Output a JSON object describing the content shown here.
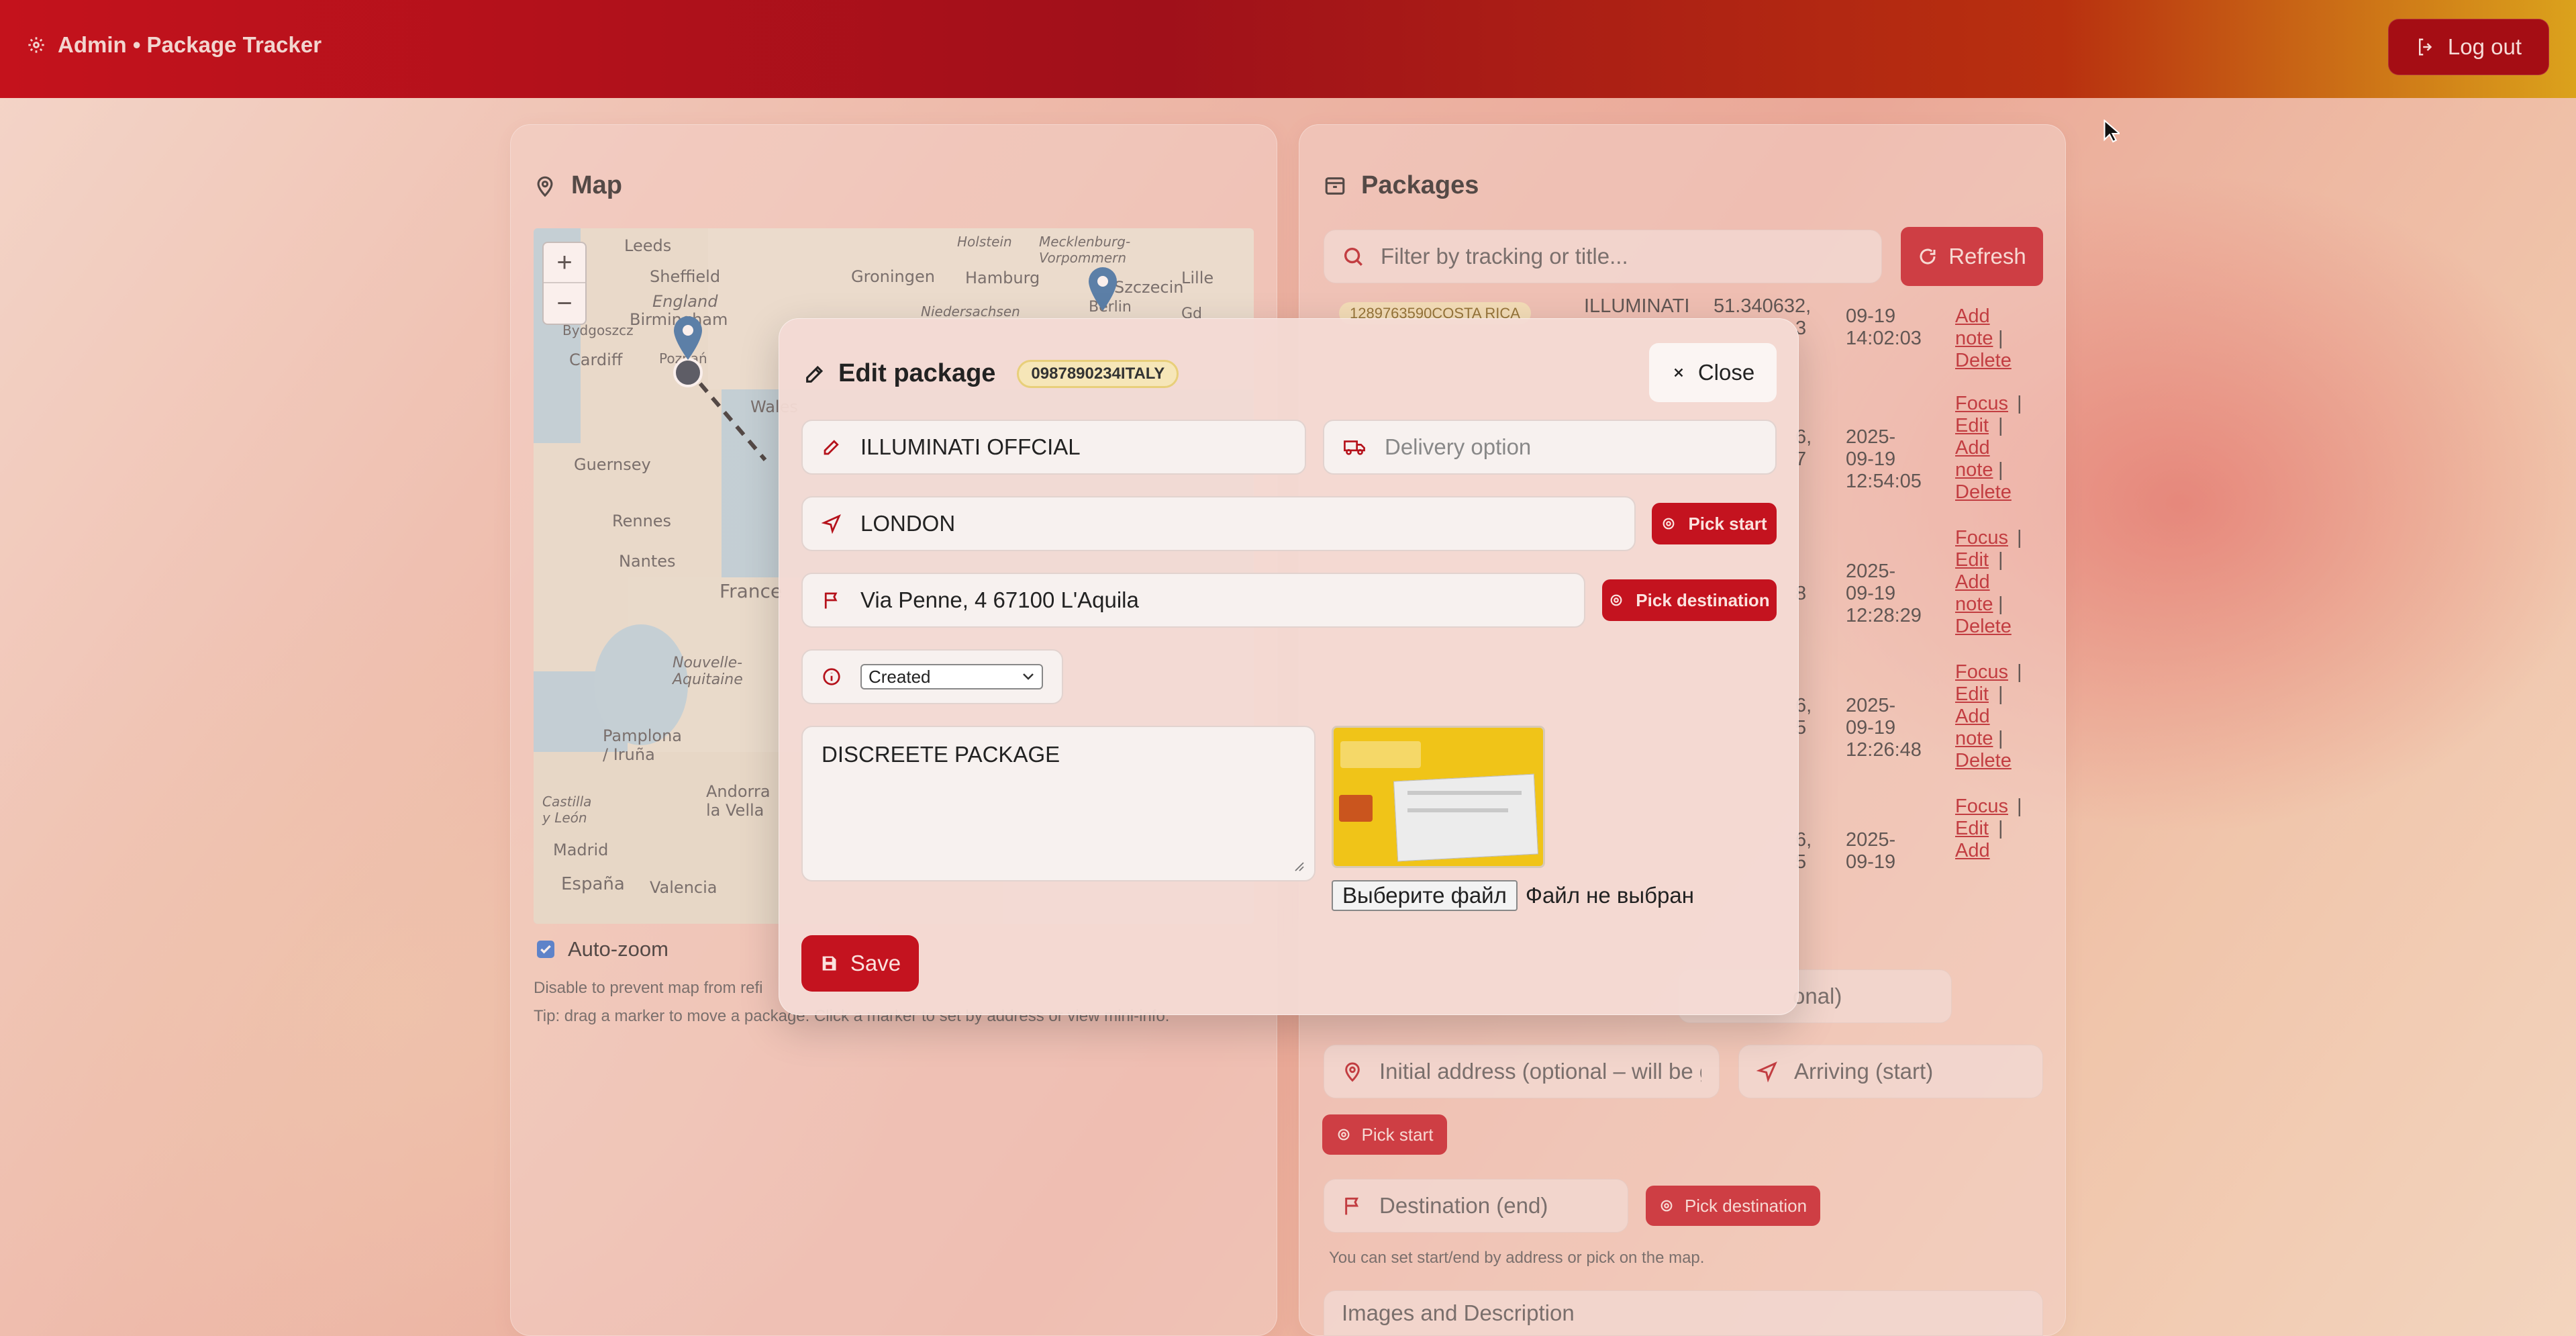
{
  "topbar": {
    "title": "Admin • Package Tracker",
    "logout_label": "Log out"
  },
  "map_panel": {
    "title": "Map",
    "labels": [
      "Leeds",
      "Sheffield",
      "England",
      "Cardiff",
      "Birmingham",
      "Guernsey",
      "Rennes",
      "Nantes",
      "France",
      "Nouvelle-Aquitaine",
      "Pamplona / Iruña",
      "Castilla y León",
      "Madrid",
      "España",
      "Valencia",
      "Andorra la Vella",
      "Groningen",
      "Hamburg",
      "Holstein",
      "Mecklenburg-Vorpommern",
      "Szczecin",
      "Niedersachsen",
      "Bydgoszcz",
      "Poznań",
      "Wales",
      "Berlin",
      "Lille",
      "Gd"
    ],
    "zoom_in": "+",
    "zoom_out": "−",
    "autozoom_label": "Auto-zoom",
    "hint1": "Disable to prevent map from refi",
    "hint2": "Tip: drag a marker to move a package. Click a marker to set by address or view mini-info."
  },
  "packages_panel": {
    "title": "Packages",
    "filter_placeholder": "Filter by tracking or title...",
    "refresh_label": "Refresh",
    "row0": {
      "tracking": "1289763590COSTA RICA",
      "title": "ILLUMINATI",
      "coords": "51.340632,",
      "coords2": "3",
      "date1": "09-19",
      "date2": "14:02:03",
      "actions": [
        "Add",
        "note",
        "Delete"
      ]
    },
    "rows": [
      {
        "c1": "6,",
        "c2": "7",
        "d1": "2025-",
        "d2": "09-19",
        "d3": "12:54:05"
      },
      {
        "c1": "8",
        "d1": "2025-",
        "d2": "09-19",
        "d3": "12:28:29"
      },
      {
        "c1": "6,",
        "c2": "5",
        "d1": "2025-",
        "d2": "09-19",
        "d3": "12:26:48"
      },
      {
        "c1": "6,",
        "c2": "5",
        "d1": "2025-",
        "d2": "09-19"
      }
    ],
    "act": {
      "focus": "Focus",
      "edit": "Edit",
      "add": "Add",
      "note": "note",
      "delete": "Delete",
      "sep": "|"
    },
    "form": {
      "optional_tail": "onal)",
      "initial_address": "Initial address (optional – will be g",
      "arriving": "Arriving (start)",
      "pick_start": "Pick start",
      "destination": "Destination (end)",
      "pick_destination": "Pick destination",
      "hint": "You can set start/end by address or pick on the map.",
      "images": "Images and Description"
    }
  },
  "modal": {
    "title": "Edit package",
    "tracking_badge": "0987890234ITALY",
    "close_label": "Close",
    "title_value": "ILLUMINATI OFFCIAL",
    "delivery_placeholder": "Delivery option",
    "start_value": "LONDON",
    "pick_start": "Pick start",
    "dest_value": "Via Penne, 4 67100 L'Aquila",
    "pick_destination": "Pick destination",
    "status_selected": "Created",
    "description": "DISCREETE PACKAGE",
    "file_button": "Выберите файл",
    "file_status": "Файл не выбран",
    "save_label": "Save"
  }
}
